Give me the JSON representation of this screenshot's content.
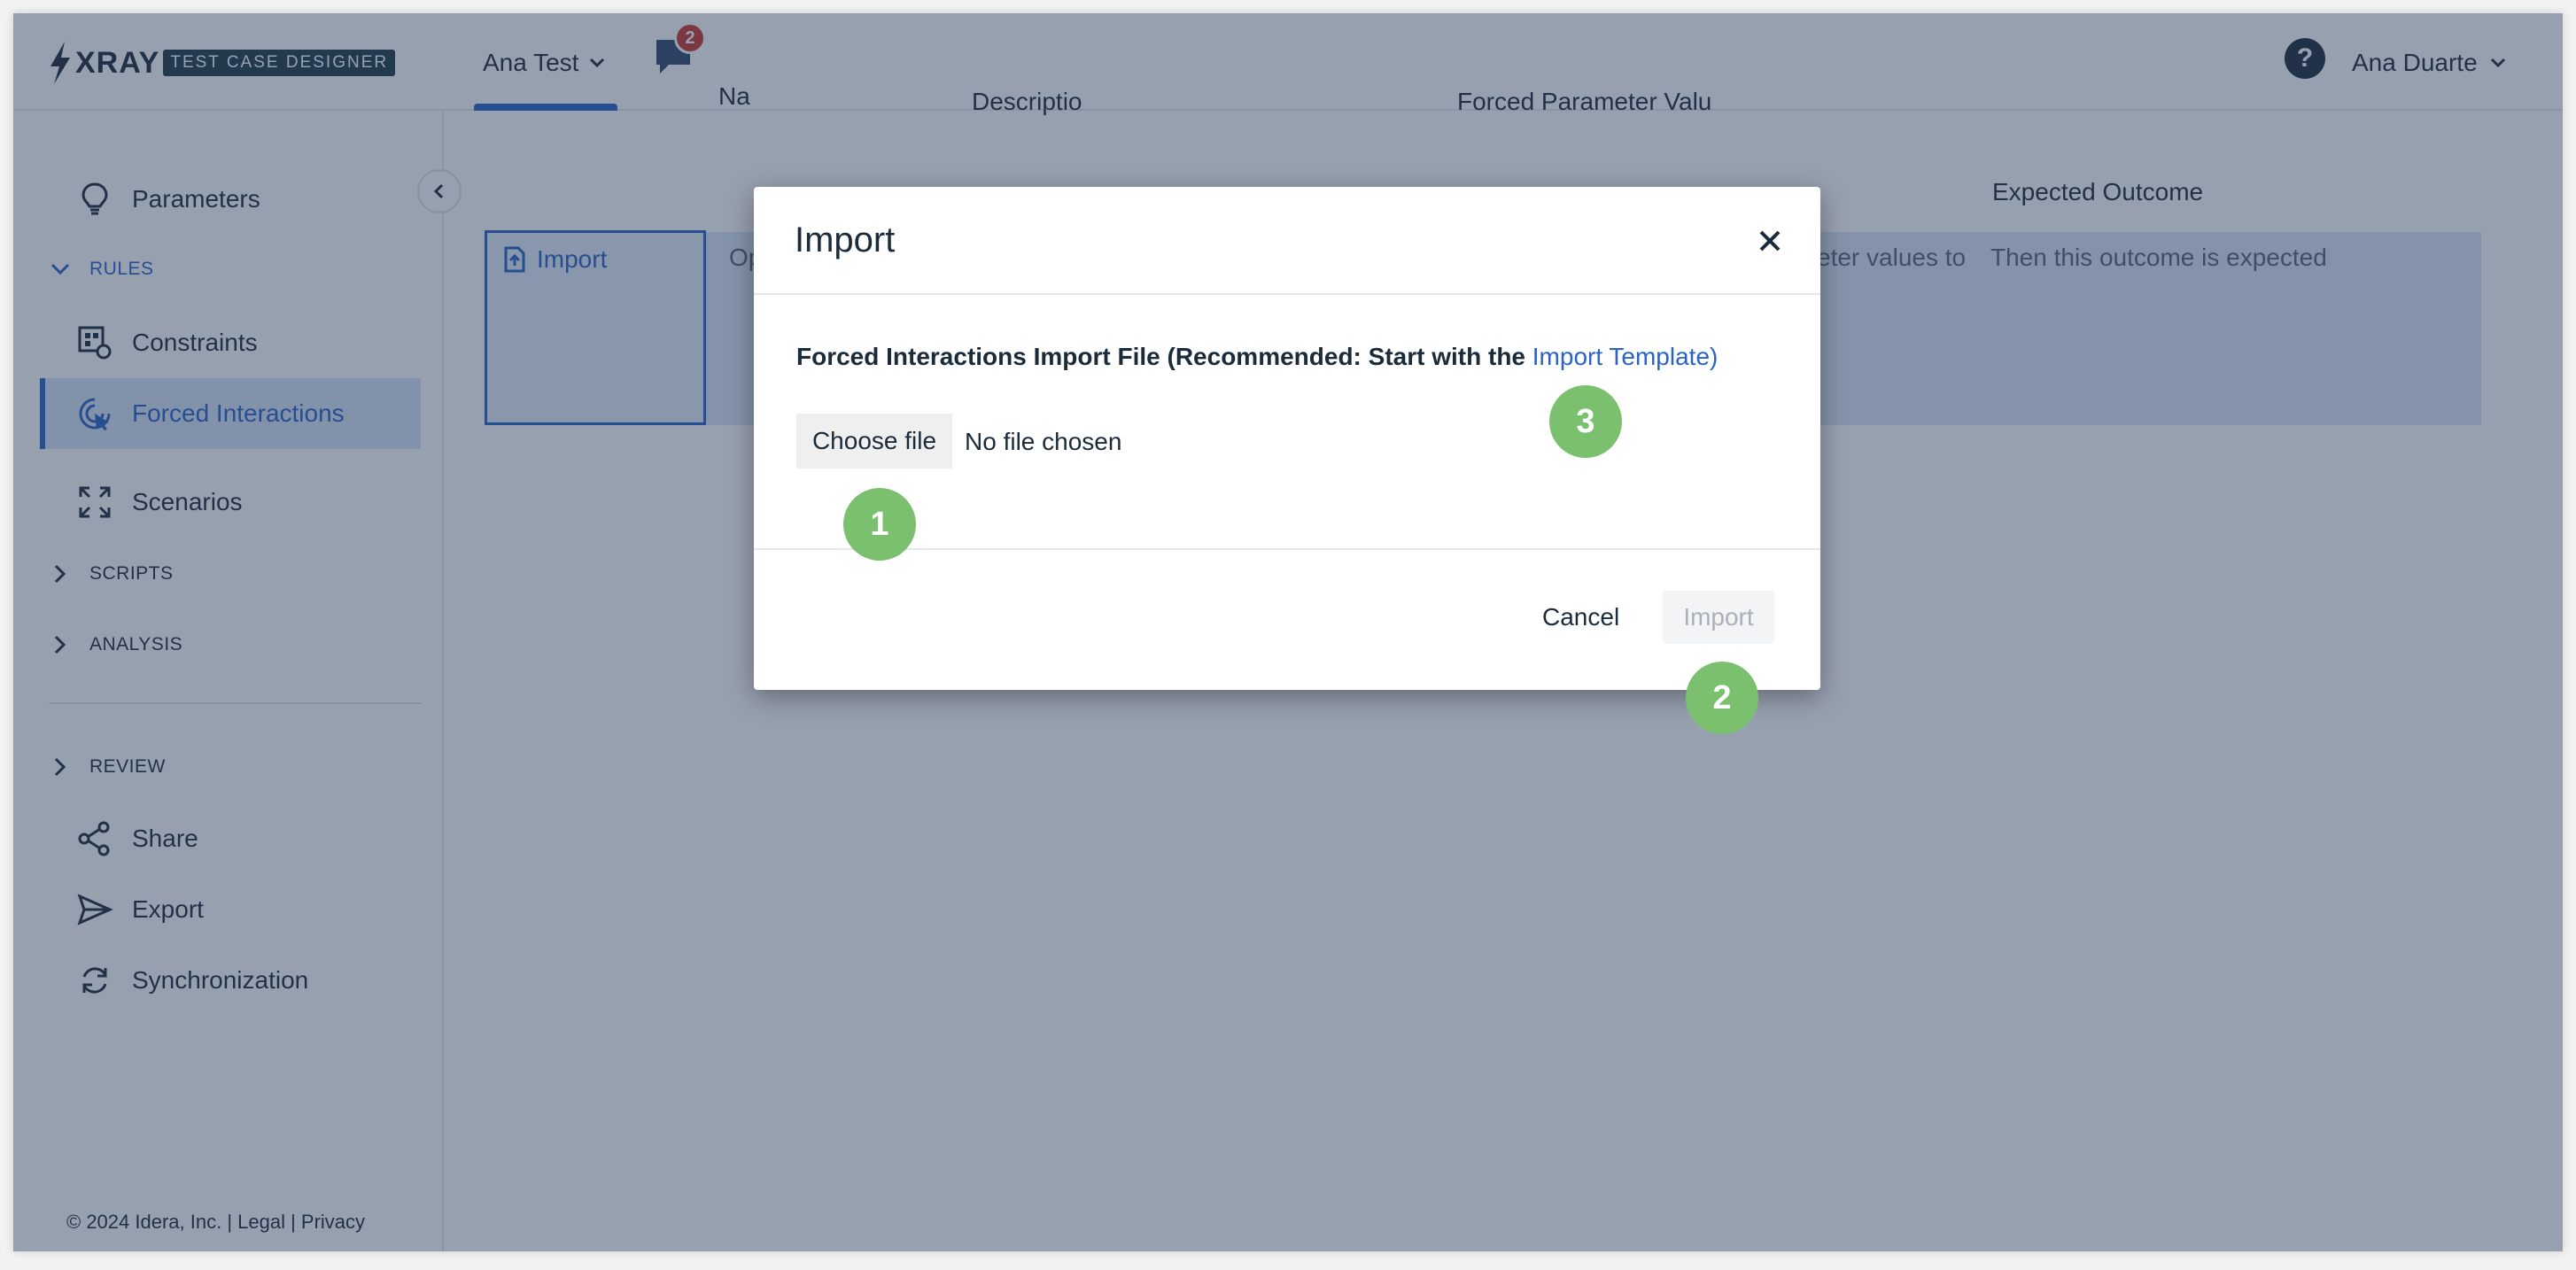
{
  "header": {
    "logo_text": "XRAY",
    "logo_badge": "TEST CASE DESIGNER",
    "project_name": "Ana Test",
    "notification_count": "2",
    "help_symbol": "?",
    "user_name": "Ana Duarte"
  },
  "sidebar": {
    "parameters": "Parameters",
    "rules_section": "RULES",
    "constraints": "Constraints",
    "forced_interactions": "Forced Interactions",
    "scenarios": "Scenarios",
    "scripts_section": "SCRIPTS",
    "analysis_section": "ANALYSIS",
    "review_section": "REVIEW",
    "share": "Share",
    "export": "Export",
    "synchronization": "Synchronization",
    "footer": "© 2024 Idera, Inc. | Legal | Privacy"
  },
  "table": {
    "col_name_partial": "Na",
    "col_description_partial": "Descriptio",
    "col_forced_partial": "Forced Parameter Valu",
    "col_expected": "Expected Outcome",
    "import_cell_label": "Import",
    "row_desc_partial": "Op",
    "row_forced_partial": "eter values to",
    "row_expected": "Then this outcome is expected"
  },
  "modal": {
    "title": "Import",
    "file_label": "Forced Interactions Import File (Recommended: Start with the ",
    "template_link": "Import Template",
    "close_paren": ")",
    "choose_file": "Choose file",
    "no_file": "No file chosen",
    "cancel": "Cancel",
    "import": "Import"
  },
  "markers": [
    "1",
    "2",
    "3"
  ],
  "colors": {
    "accent": "#2a63c4",
    "marker": "#7ac06f",
    "badge": "#c9362f"
  }
}
